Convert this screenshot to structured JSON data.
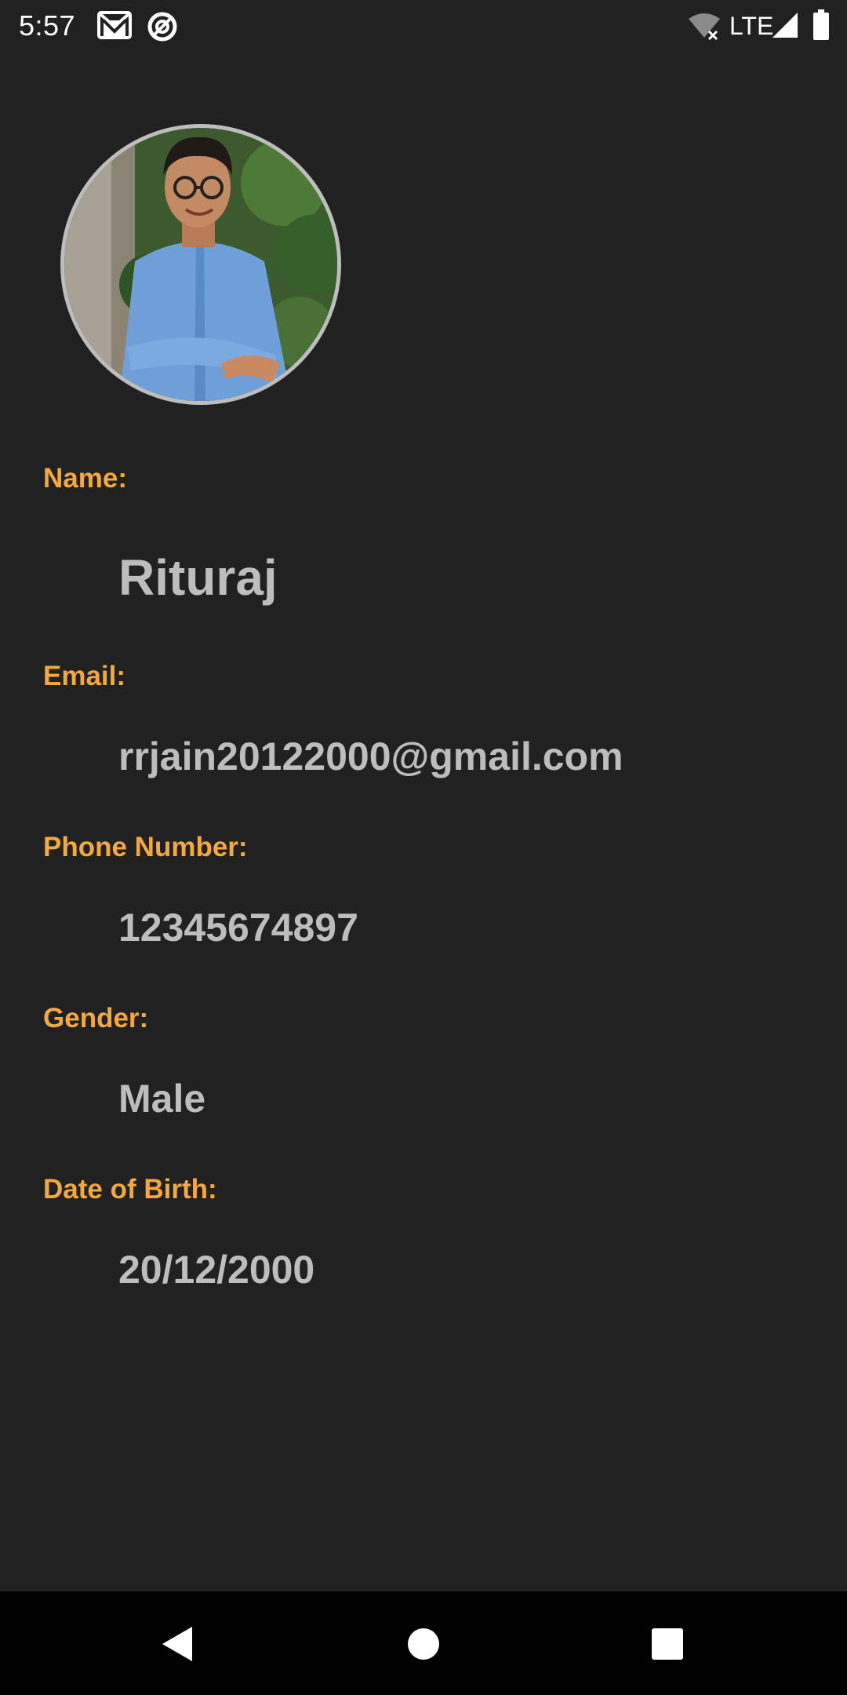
{
  "status_bar": {
    "time": "5:57",
    "network": "LTE",
    "icons": [
      "gmail-icon",
      "sync-icon",
      "wifi-off-icon",
      "signal-icon",
      "battery-icon"
    ]
  },
  "profile": {
    "avatar": "profile-photo",
    "fields": {
      "name": {
        "label": "Name:",
        "value": "Rituraj"
      },
      "email": {
        "label": "Email:",
        "value": "rrjain20122000@gmail.com"
      },
      "phone": {
        "label": "Phone Number:",
        "value": "12345674897"
      },
      "gender": {
        "label": "Gender:",
        "value": "Male"
      },
      "dob": {
        "label": "Date of Birth:",
        "value": "20/12/2000"
      }
    }
  },
  "nav_bar": {
    "buttons": [
      "back-icon",
      "home-icon",
      "recents-icon"
    ]
  },
  "colors": {
    "background": "#212121",
    "label": "#f5a93c",
    "value": "#bdbdbd",
    "nav_background": "#000000"
  }
}
